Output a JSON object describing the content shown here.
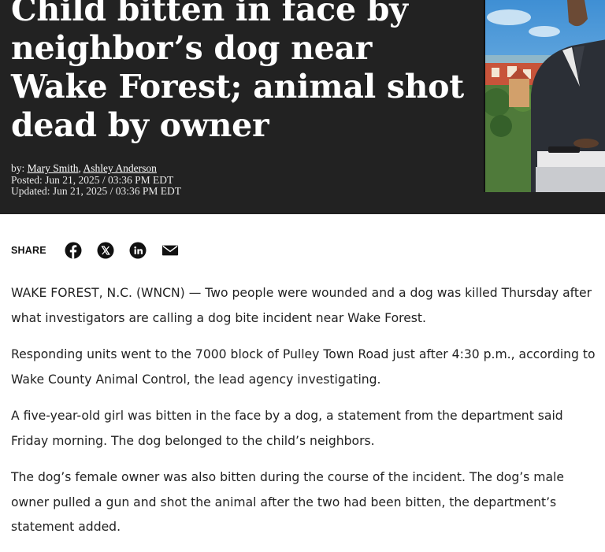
{
  "article": {
    "headline": "Child bitten in face by neighbor’s dog near Wake Forest; animal shot dead by owner",
    "byline_prefix": "by:",
    "authors": [
      "Mary Smith",
      "Ashley Anderson"
    ],
    "posted": "Posted: Jun 21, 2025 / 03:36 PM EDT",
    "updated": "Updated: Jun 21, 2025 / 03:36 PM EDT",
    "paragraphs": [
      "WAKE FOREST, N.C. (WNCN) — Two people were wounded and a dog was killed Thursday after what investigators are calling a dog bite incident near Wake Forest.",
      "Responding units went to the 7000 block of Pulley Town Road just after 4:30 p.m., according to Wake County Animal Control, the lead agency investigating.",
      "A five-year-old girl was bitten in the face by a dog, a statement from the department said Friday morning. The dog belonged to the child’s neighbors.",
      "The dog’s female owner was also bitten during the course of the incident. The dog’s male owner pulled a gun and shot the animal after the two had been bitten, the department’s statement added."
    ]
  },
  "share": {
    "label": "SHARE",
    "icons": [
      "facebook-icon",
      "x-icon",
      "linkedin-icon",
      "email-icon"
    ]
  },
  "colors": {
    "hero_background": "#222222",
    "headline_text": "#ffffff",
    "body_text": "#222222"
  }
}
